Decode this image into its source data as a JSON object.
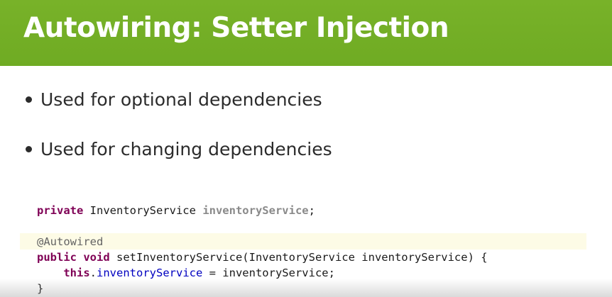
{
  "slide": {
    "title": "Autowiring: Setter Injection",
    "bullets": [
      "Used for optional dependencies",
      "Used for changing dependencies"
    ],
    "code": {
      "line1": {
        "kw": "private",
        "type": " InventoryService ",
        "field": "inventoryService",
        "end": ";"
      },
      "line2": {
        "annotation": "@Autowired"
      },
      "line3": {
        "kw1": "public",
        "kw2": "void",
        "rest": " setInventoryService(InventoryService inventoryService) {"
      },
      "line4": {
        "indent": "    ",
        "kw": "this",
        "dot": ".",
        "field": "inventoryService",
        "rest": " = inventoryService;"
      },
      "line5": {
        "text": "}"
      }
    }
  },
  "colors": {
    "title_bar": "#74ae26",
    "title_text": "#ffffff",
    "keyword": "#7f0055",
    "annotation": "#646464",
    "field": "#0000c0",
    "highlight": "#fdfbe6"
  }
}
